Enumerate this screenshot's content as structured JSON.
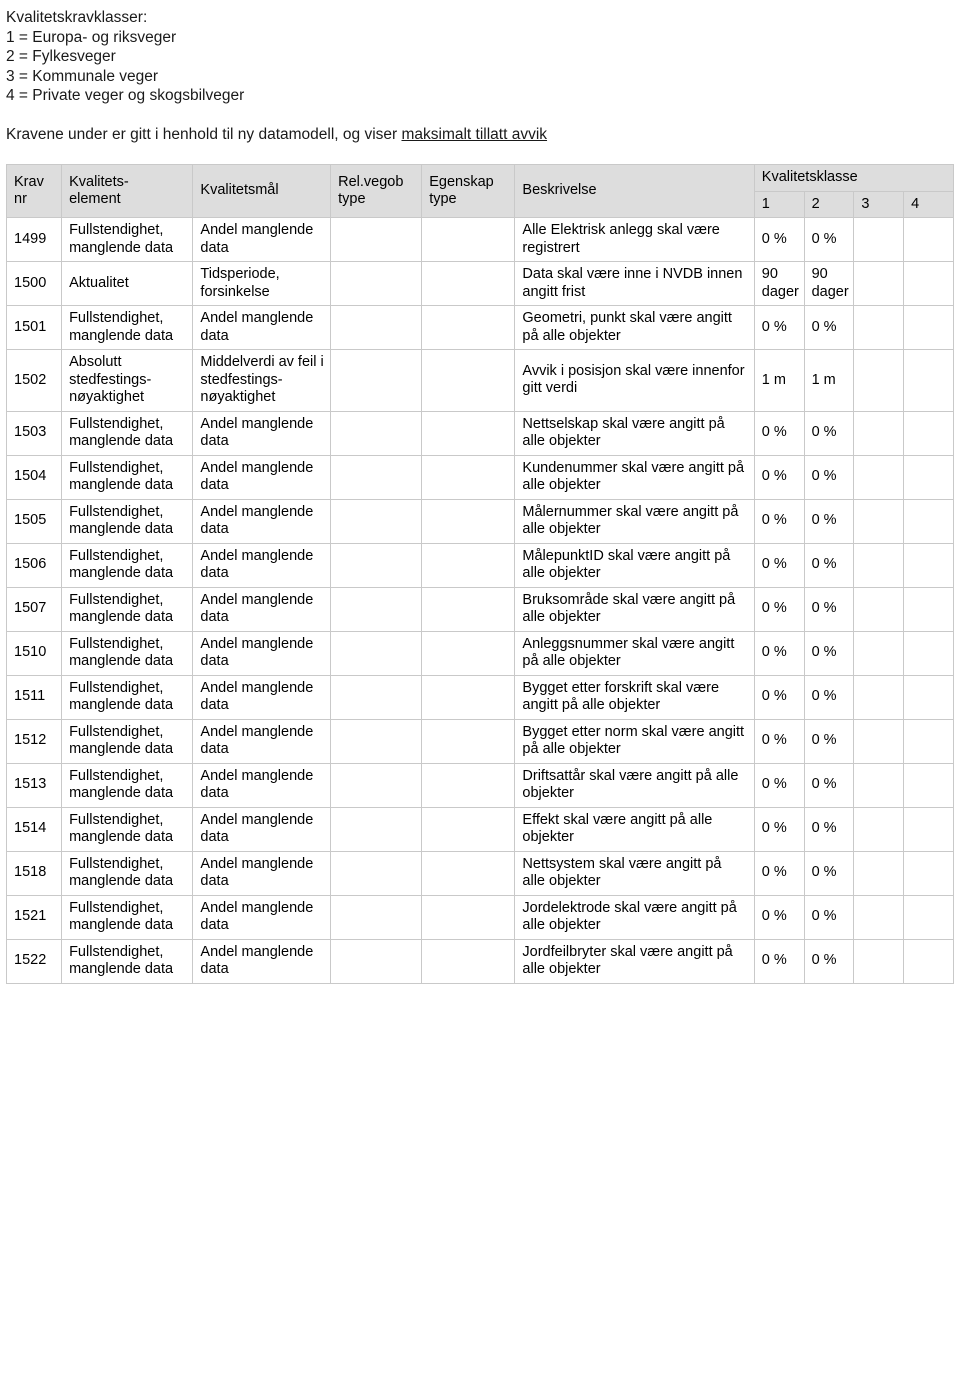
{
  "intro": {
    "heading": "Kvalitetskravklasser:",
    "classes": [
      "1 = Europa- og riksveger",
      "2 = Fylkesveger",
      "3 = Kommunale veger",
      "4 = Private veger og skogsbilveger"
    ],
    "lede_before": "Kravene under er gitt i henhold til ny datamodell, og viser ",
    "lede_underlined": "maksimalt tillatt avvik"
  },
  "table": {
    "headers": {
      "krav_nr": "Krav\nnr",
      "kvalitetselement": "Kvalitets-\nelement",
      "kvalitetsmal": "Kvalitetsmål",
      "rel_vegob_type": "Rel.vegob\ntype",
      "egenskap_type": "Egenskap\ntype",
      "beskrivelse": "Beskrivelse",
      "kvalitetsklasse": "Kvalitetsklasse",
      "k1": "1",
      "k2": "2",
      "k3": "3",
      "k4": "4"
    },
    "rows": [
      {
        "krav_nr": "1499",
        "kvalitetselement": "Fullstendighet, manglende data",
        "kvalitetsmal": "Andel manglende data",
        "rel_vegob_type": "",
        "egenskap_type": "",
        "beskrivelse": "Alle Elektrisk anlegg skal være registrert",
        "k1": "0 %",
        "k2": "0 %",
        "k3": "",
        "k4": ""
      },
      {
        "krav_nr": "1500",
        "kvalitetselement": "Aktualitet",
        "kvalitetsmal": "Tidsperiode, forsinkelse",
        "rel_vegob_type": "",
        "egenskap_type": "",
        "beskrivelse": "Data skal være inne i NVDB innen angitt frist",
        "k1": "90 dager",
        "k2": "90 dager",
        "k3": "",
        "k4": ""
      },
      {
        "krav_nr": "1501",
        "kvalitetselement": "Fullstendighet, manglende data",
        "kvalitetsmal": "Andel manglende data",
        "rel_vegob_type": "",
        "egenskap_type": "",
        "beskrivelse": "Geometri, punkt skal være angitt på alle objekter",
        "k1": "0 %",
        "k2": "0 %",
        "k3": "",
        "k4": ""
      },
      {
        "krav_nr": "1502",
        "kvalitetselement": "Absolutt stedfestings-nøyaktighet",
        "kvalitetsmal": "Middelverdi av feil i stedfestings-nøyaktighet",
        "rel_vegob_type": "",
        "egenskap_type": "",
        "beskrivelse": "Avvik i posisjon skal være innenfor gitt verdi",
        "k1": "1 m",
        "k2": "1 m",
        "k3": "",
        "k4": ""
      },
      {
        "krav_nr": "1503",
        "kvalitetselement": "Fullstendighet, manglende data",
        "kvalitetsmal": "Andel manglende data",
        "rel_vegob_type": "",
        "egenskap_type": "",
        "beskrivelse": "Nettselskap skal være angitt på alle objekter",
        "k1": "0 %",
        "k2": "0 %",
        "k3": "",
        "k4": ""
      },
      {
        "krav_nr": "1504",
        "kvalitetselement": "Fullstendighet, manglende data",
        "kvalitetsmal": "Andel manglende data",
        "rel_vegob_type": "",
        "egenskap_type": "",
        "beskrivelse": "Kundenummer skal være angitt på alle objekter",
        "k1": "0 %",
        "k2": "0 %",
        "k3": "",
        "k4": ""
      },
      {
        "krav_nr": "1505",
        "kvalitetselement": "Fullstendighet, manglende data",
        "kvalitetsmal": "Andel manglende data",
        "rel_vegob_type": "",
        "egenskap_type": "",
        "beskrivelse": "Målernummer skal være angitt på alle objekter",
        "k1": "0 %",
        "k2": "0 %",
        "k3": "",
        "k4": ""
      },
      {
        "krav_nr": "1506",
        "kvalitetselement": "Fullstendighet, manglende data",
        "kvalitetsmal": "Andel manglende data",
        "rel_vegob_type": "",
        "egenskap_type": "",
        "beskrivelse": "MålepunktID skal være angitt på alle objekter",
        "k1": "0 %",
        "k2": "0 %",
        "k3": "",
        "k4": ""
      },
      {
        "krav_nr": "1507",
        "kvalitetselement": "Fullstendighet, manglende data",
        "kvalitetsmal": "Andel manglende data",
        "rel_vegob_type": "",
        "egenskap_type": "",
        "beskrivelse": "Bruksområde skal være angitt på alle objekter",
        "k1": "0 %",
        "k2": "0 %",
        "k3": "",
        "k4": ""
      },
      {
        "krav_nr": "1510",
        "kvalitetselement": "Fullstendighet, manglende data",
        "kvalitetsmal": "Andel manglende data",
        "rel_vegob_type": "",
        "egenskap_type": "",
        "beskrivelse": "Anleggsnummer skal være angitt på alle objekter",
        "k1": "0 %",
        "k2": "0 %",
        "k3": "",
        "k4": ""
      },
      {
        "krav_nr": "1511",
        "kvalitetselement": "Fullstendighet, manglende data",
        "kvalitetsmal": "Andel manglende data",
        "rel_vegob_type": "",
        "egenskap_type": "",
        "beskrivelse": "Bygget etter forskrift skal være angitt på alle objekter",
        "k1": "0 %",
        "k2": "0 %",
        "k3": "",
        "k4": ""
      },
      {
        "krav_nr": "1512",
        "kvalitetselement": "Fullstendighet, manglende data",
        "kvalitetsmal": "Andel manglende data",
        "rel_vegob_type": "",
        "egenskap_type": "",
        "beskrivelse": "Bygget etter norm skal være angitt på alle objekter",
        "k1": "0 %",
        "k2": "0 %",
        "k3": "",
        "k4": ""
      },
      {
        "krav_nr": "1513",
        "kvalitetselement": "Fullstendighet, manglende data",
        "kvalitetsmal": "Andel manglende data",
        "rel_vegob_type": "",
        "egenskap_type": "",
        "beskrivelse": "Driftsattår skal være angitt på alle objekter",
        "k1": "0 %",
        "k2": "0 %",
        "k3": "",
        "k4": ""
      },
      {
        "krav_nr": "1514",
        "kvalitetselement": "Fullstendighet, manglende data",
        "kvalitetsmal": "Andel manglende data",
        "rel_vegob_type": "",
        "egenskap_type": "",
        "beskrivelse": "Effekt skal være angitt på alle objekter",
        "k1": "0 %",
        "k2": "0 %",
        "k3": "",
        "k4": ""
      },
      {
        "krav_nr": "1518",
        "kvalitetselement": "Fullstendighet, manglende data",
        "kvalitetsmal": "Andel manglende data",
        "rel_vegob_type": "",
        "egenskap_type": "",
        "beskrivelse": "Nettsystem skal være angitt på alle objekter",
        "k1": "0 %",
        "k2": "0 %",
        "k3": "",
        "k4": ""
      },
      {
        "krav_nr": "1521",
        "kvalitetselement": "Fullstendighet, manglende data",
        "kvalitetsmal": "Andel manglende data",
        "rel_vegob_type": "",
        "egenskap_type": "",
        "beskrivelse": "Jordelektrode skal være angitt på alle objekter",
        "k1": "0 %",
        "k2": "0 %",
        "k3": "",
        "k4": ""
      },
      {
        "krav_nr": "1522",
        "kvalitetselement": "Fullstendighet, manglende data",
        "kvalitetsmal": "Andel manglende data",
        "rel_vegob_type": "",
        "egenskap_type": "",
        "beskrivelse": "Jordfeilbryter skal være angitt på alle objekter",
        "k1": "0 %",
        "k2": "0 %",
        "k3": "",
        "k4": ""
      }
    ]
  }
}
